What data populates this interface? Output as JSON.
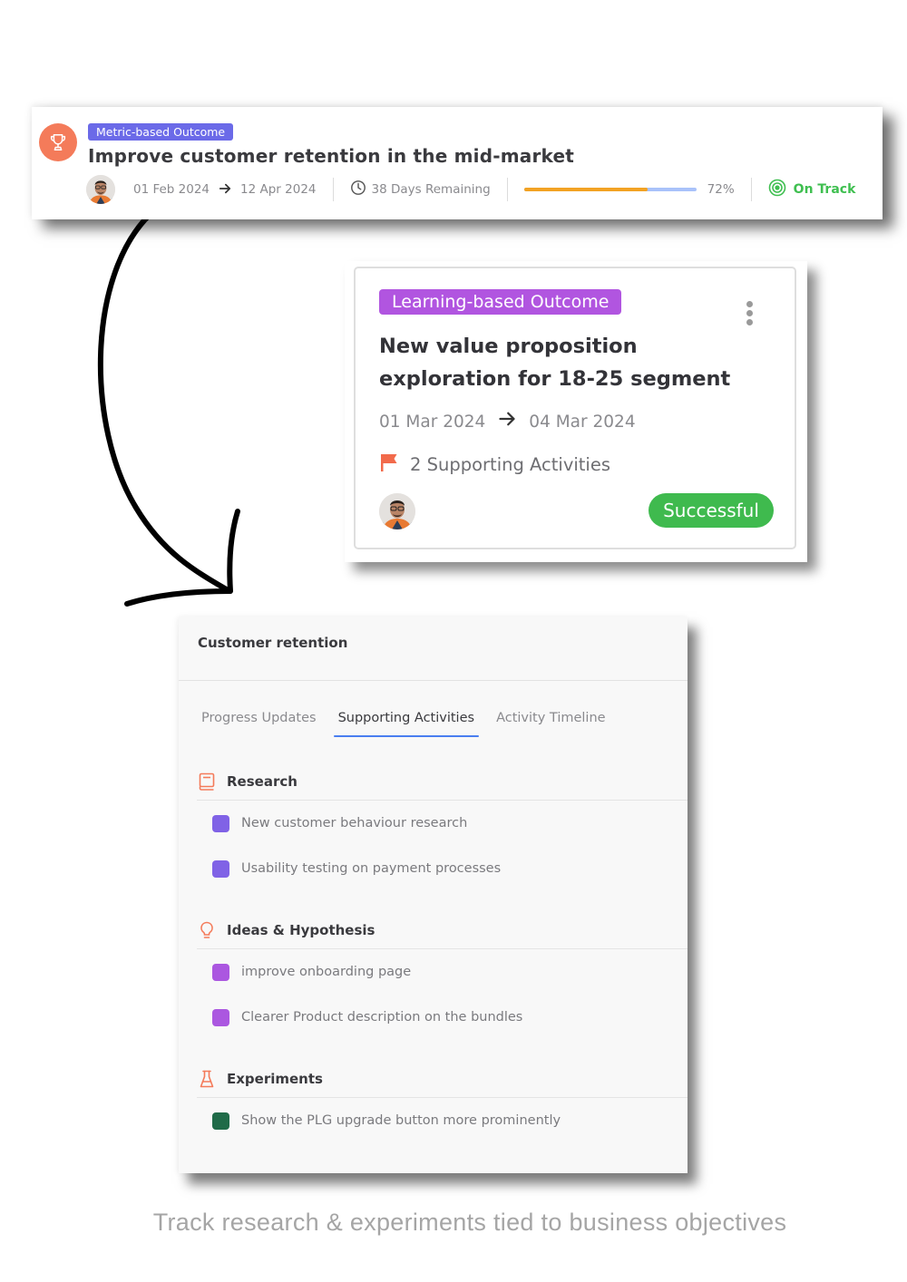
{
  "metric_card": {
    "tag": "Metric-based Outcome",
    "title": "Improve customer retention in the mid-market",
    "start_date": "01 Feb 2024",
    "end_date": "12 Apr 2024",
    "days_remaining": "38 Days Remaining",
    "progress_percent": 72,
    "progress_label": "72%",
    "status": "On Track",
    "icons": {
      "outcome": "trophy-icon",
      "clock": "clock-icon",
      "status": "target-icon",
      "date_arrow": "arrow-right-icon"
    },
    "colors": {
      "tag_bg": "#6b6ae8",
      "icon_bg": "#f47b5a",
      "progress_fill": "#f2a223",
      "progress_track": "#a9c2fa",
      "status": "#3fbf50"
    }
  },
  "learning_card": {
    "tag": "Learning-based Outcome",
    "title": "New value proposition exploration for 18-25 segment",
    "start_date": "01 Mar 2024",
    "end_date": "04 Mar 2024",
    "supporting_activities": "2 Supporting Activities",
    "status": "Successful",
    "icons": {
      "menu": "kebab-menu-icon",
      "activities": "flag-icon"
    },
    "colors": {
      "tag_bg": "#b155e0",
      "status_bg": "#3fba4e",
      "flag": "#f26a4b"
    }
  },
  "panel": {
    "title": "Customer retention",
    "tabs": [
      {
        "label": "Progress Updates",
        "active": false
      },
      {
        "label": "Supporting Activities",
        "active": true
      },
      {
        "label": "Activity Timeline",
        "active": false
      }
    ],
    "sections": [
      {
        "label": "Research",
        "icon": "book-icon",
        "items": [
          {
            "label": "New customer behaviour research",
            "color": "#8062e6"
          },
          {
            "label": "Usability testing on payment processes",
            "color": "#8062e6"
          }
        ]
      },
      {
        "label": "Ideas & Hypothesis",
        "icon": "lightbulb-icon",
        "items": [
          {
            "label": "improve onboarding page",
            "color": "#ab57e0"
          },
          {
            "label": "Clearer Product description on the bundles",
            "color": "#ab57e0"
          }
        ]
      },
      {
        "label": "Experiments",
        "icon": "flask-icon",
        "items": [
          {
            "label": "Show the PLG upgrade button more prominently",
            "color": "#1f6b48"
          }
        ]
      }
    ]
  },
  "caption": "Track research & experiments tied to business objectives"
}
